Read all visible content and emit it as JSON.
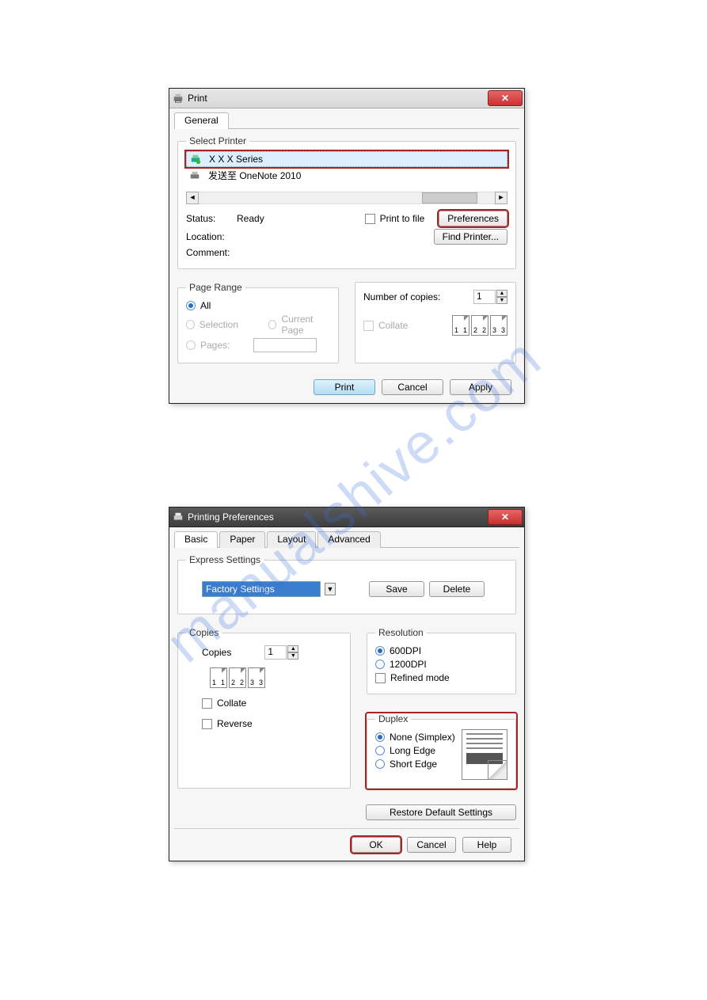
{
  "watermark": "manualshive.com",
  "print_dialog": {
    "title": "Print",
    "tab_general": "General",
    "select_printer_legend": "Select Printer",
    "printer1": "X X X Series",
    "printer2": "发送至 OneNote 2010",
    "status_label": "Status:",
    "status_value": "Ready",
    "location_label": "Location:",
    "comment_label": "Comment:",
    "print_to_file": "Print to file",
    "preferences": "Preferences",
    "find_printer": "Find Printer...",
    "page_range_legend": "Page Range",
    "all": "All",
    "selection": "Selection",
    "current_page": "Current Page",
    "pages": "Pages:",
    "copies_legend": " ",
    "num_copies_label": "Number of copies:",
    "num_copies_value": "1",
    "collate": "Collate",
    "btn_print": "Print",
    "btn_cancel": "Cancel",
    "btn_apply": "Apply"
  },
  "pref_dialog": {
    "title": "Printing Preferences",
    "tabs": {
      "basic": "Basic",
      "paper": "Paper",
      "layout": "Layout",
      "advanced": "Advanced"
    },
    "express_legend": "Express Settings",
    "express_value": "Factory Settings",
    "btn_save": "Save",
    "btn_delete": "Delete",
    "copies_legend": "Copies",
    "copies_label": "Copies",
    "copies_value": "1",
    "collate": "Collate",
    "reverse": "Reverse",
    "resolution_legend": "Resolution",
    "res_600": "600DPI",
    "res_1200": "1200DPI",
    "refined": "Refined mode",
    "duplex_legend": "Duplex",
    "duplex_none": "None (Simplex)",
    "duplex_long": "Long Edge",
    "duplex_short": "Short Edge",
    "restore": "Restore Default Settings",
    "btn_ok": "OK",
    "btn_cancel": "Cancel",
    "btn_help": "Help"
  }
}
